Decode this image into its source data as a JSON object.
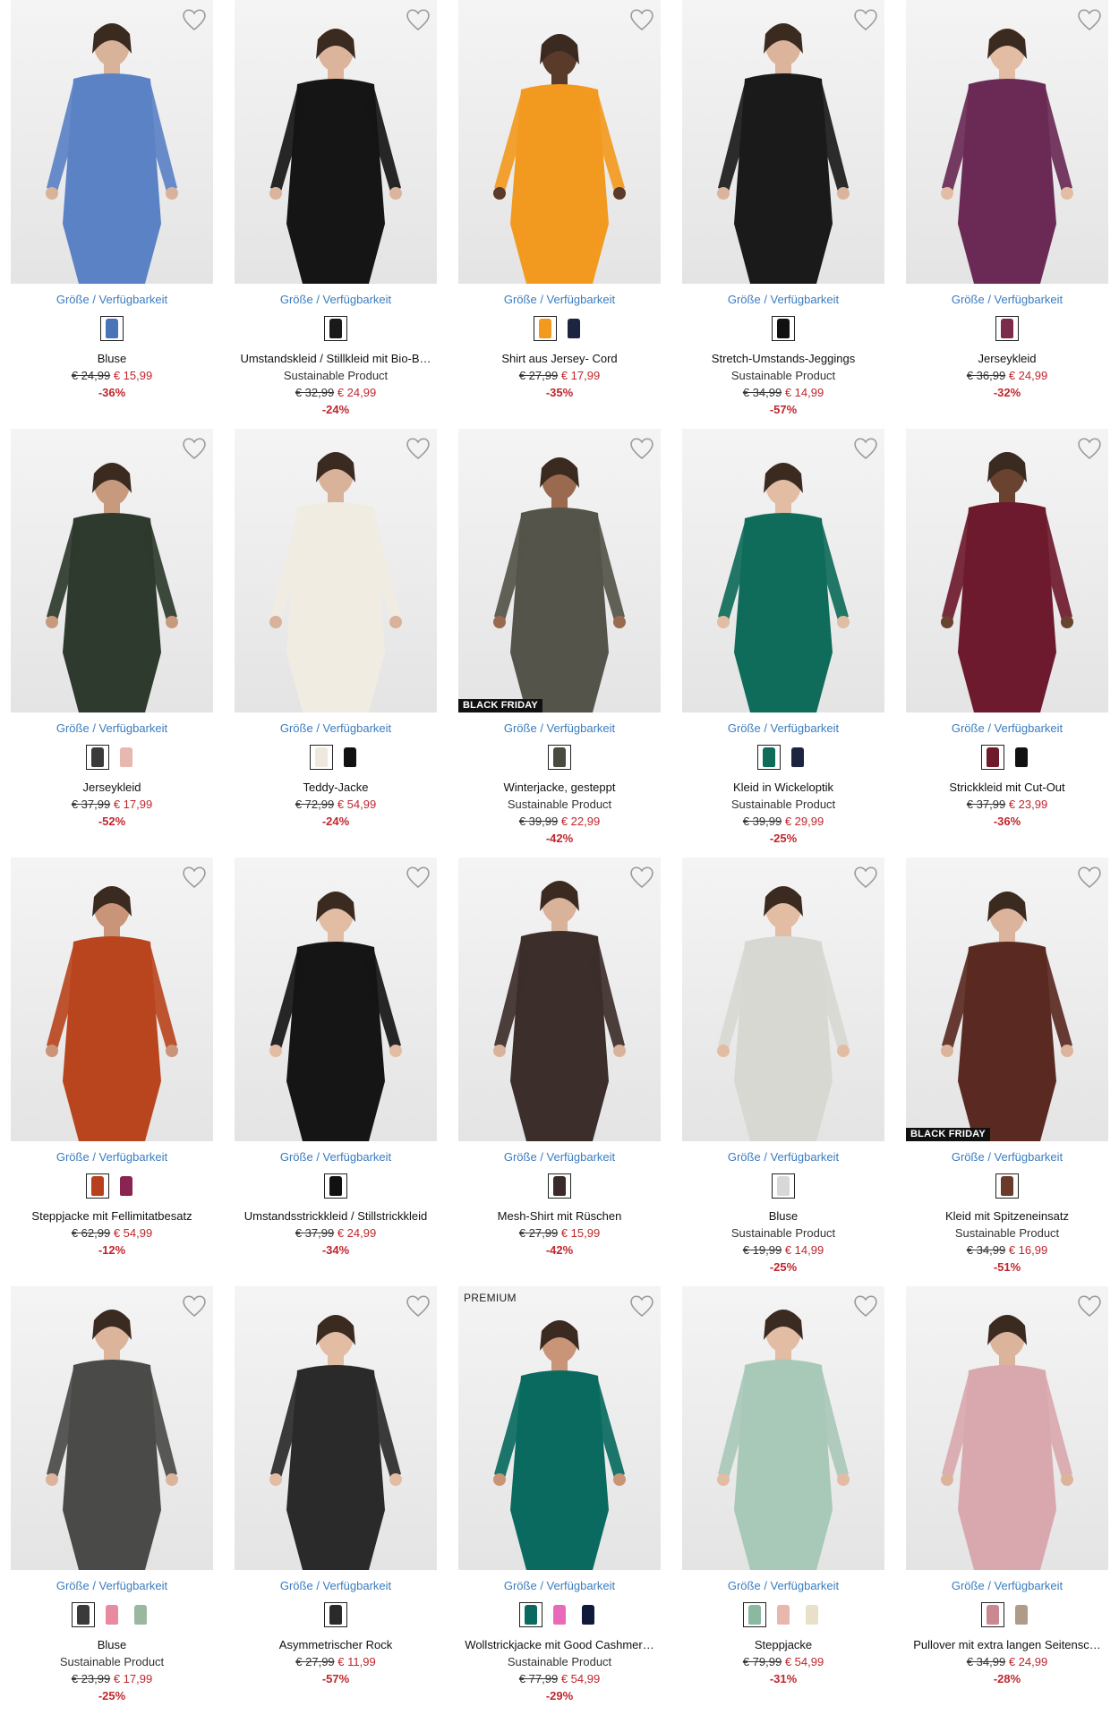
{
  "availability_label": "Größe / Verfügbarkeit",
  "colors": {
    "price_new": "#c0262d",
    "link": "#3a7cbf",
    "badge_bg": "#111111"
  },
  "products": [
    {
      "name": "Bluse",
      "sustainable": "",
      "old_price": "€ 24,99",
      "new_price": "€ 15,99",
      "discount": "-36%",
      "badge": "",
      "swatches": [
        "#4a74b8"
      ],
      "garment": "#5b82c4",
      "skin": "#d9b29a"
    },
    {
      "name": "Umstandskleid / Stillkleid mit Bio-B…",
      "sustainable": "Sustainable Product",
      "old_price": "€ 32,99",
      "new_price": "€ 24,99",
      "discount": "-24%",
      "badge": "",
      "swatches": [
        "#1a1a1a"
      ],
      "garment": "#151515",
      "skin": "#dcb49c"
    },
    {
      "name": "Shirt aus Jersey- Cord",
      "sustainable": "",
      "old_price": "€ 27,99",
      "new_price": "€ 17,99",
      "discount": "-35%",
      "badge": "",
      "swatches": [
        "#f39a1e",
        "#1c2440"
      ],
      "garment": "#f29a20",
      "skin": "#5a3a2a"
    },
    {
      "name": "Stretch-Umstands-Jeggings",
      "sustainable": "Sustainable Product",
      "old_price": "€ 34,99",
      "new_price": "€ 14,99",
      "discount": "-57%",
      "badge": "",
      "swatches": [
        "#111111"
      ],
      "garment": "#1a1a1a",
      "skin": "#dcb49c"
    },
    {
      "name": "Jerseykleid",
      "sustainable": "",
      "old_price": "€ 36,99",
      "new_price": "€ 24,99",
      "discount": "-32%",
      "badge": "",
      "swatches": [
        "#7a2c4a"
      ],
      "garment": "#6a2a55",
      "skin": "#e2bca3"
    },
    {
      "name": "Jerseykleid",
      "sustainable": "",
      "old_price": "€ 37,99",
      "new_price": "€ 17,99",
      "discount": "-52%",
      "badge": "",
      "swatches": [
        "#3a3a3a",
        "#e6b8b0"
      ],
      "garment": "#2e3a2e",
      "skin": "#c79a7e"
    },
    {
      "name": "Teddy-Jacke",
      "sustainable": "",
      "old_price": "€ 72,99",
      "new_price": "€ 54,99",
      "discount": "-24%",
      "badge": "",
      "swatches": [
        "#efe8dc",
        "#111111"
      ],
      "garment": "#f1ece2",
      "skin": "#d9b29a"
    },
    {
      "name": "Winterjacke, gesteppt",
      "sustainable": "Sustainable Product",
      "old_price": "€ 39,99",
      "new_price": "€ 22,99",
      "discount": "-42%",
      "badge": "BLACK FRIDAY",
      "swatches": [
        "#4a4a40"
      ],
      "garment": "#55544a",
      "skin": "#9a6a4e"
    },
    {
      "name": "Kleid in Wickeloptik",
      "sustainable": "Sustainable Product",
      "old_price": "€ 39,99",
      "new_price": "€ 29,99",
      "discount": "-25%",
      "badge": "",
      "swatches": [
        "#0f6b5a",
        "#1c2440"
      ],
      "garment": "#0f6b5a",
      "skin": "#e2bca3"
    },
    {
      "name": "Strickkleid mit Cut-Out",
      "sustainable": "",
      "old_price": "€ 37,99",
      "new_price": "€ 23,99",
      "discount": "-36%",
      "badge": "",
      "swatches": [
        "#6e1a2a",
        "#111111"
      ],
      "garment": "#6e1a2e",
      "skin": "#6a4230"
    },
    {
      "name": "Steppjacke mit Fellimitatbesatz",
      "sustainable": "",
      "old_price": "€ 62,99",
      "new_price": "€ 54,99",
      "discount": "-12%",
      "badge": "",
      "swatches": [
        "#b8401c",
        "#8a2450"
      ],
      "garment": "#b8451e",
      "skin": "#c99478"
    },
    {
      "name": "Umstandsstrickkleid / Stillstrickkleid",
      "sustainable": "",
      "old_price": "€ 37,99",
      "new_price": "€ 24,99",
      "discount": "-34%",
      "badge": "",
      "swatches": [
        "#111111"
      ],
      "garment": "#151515",
      "skin": "#e2bca3"
    },
    {
      "name": "Mesh-Shirt mit Rüschen",
      "sustainable": "",
      "old_price": "€ 27,99",
      "new_price": "€ 15,99",
      "discount": "-42%",
      "badge": "",
      "swatches": [
        "#3a2a2a"
      ],
      "garment": "#3c2e2a",
      "skin": "#d9b29a"
    },
    {
      "name": "Bluse",
      "sustainable": "Sustainable Product",
      "old_price": "€ 19,99",
      "new_price": "€ 14,99",
      "discount": "-25%",
      "badge": "",
      "swatches": [
        "#d8d8d8"
      ],
      "garment": "#d8d8d2",
      "skin": "#e2bca3"
    },
    {
      "name": "Kleid mit Spitzeneinsatz",
      "sustainable": "Sustainable Product",
      "old_price": "€ 34,99",
      "new_price": "€ 16,99",
      "discount": "-51%",
      "badge": "BLACK FRIDAY",
      "swatches": [
        "#6a3a2a"
      ],
      "garment": "#5a2a22",
      "skin": "#dcb49c"
    },
    {
      "name": "Bluse",
      "sustainable": "Sustainable Product",
      "old_price": "€ 23,99",
      "new_price": "€ 17,99",
      "discount": "-25%",
      "badge": "",
      "swatches": [
        "#3a3a3a",
        "#e88aa0",
        "#9ab8a0"
      ],
      "garment": "#4a4a48",
      "skin": "#dcb49c"
    },
    {
      "name": "Asymmetrischer Rock",
      "sustainable": "",
      "old_price": "€ 27,99",
      "new_price": "€ 11,99",
      "discount": "-57%",
      "badge": "",
      "swatches": [
        "#2a2a2a"
      ],
      "garment": "#2a2a2a",
      "skin": "#e2bca3"
    },
    {
      "name": "Wollstrickjacke mit Good Cashmer…",
      "sustainable": "Sustainable Product",
      "old_price": "€ 77,99",
      "new_price": "€ 54,99",
      "discount": "-29%",
      "badge": "PREMIUM",
      "swatches": [
        "#0a6a60",
        "#e86ab8",
        "#111a3a"
      ],
      "garment": "#0a6a60",
      "skin": "#c99478"
    },
    {
      "name": "Steppjacke",
      "sustainable": "",
      "old_price": "€ 79,99",
      "new_price": "€ 54,99",
      "discount": "-31%",
      "badge": "",
      "swatches": [
        "#8ab8a0",
        "#e8b8b0",
        "#e8e0c8"
      ],
      "garment": "#a8c8b8",
      "skin": "#e2bca3"
    },
    {
      "name": "Pullover mit extra langen Seitensc…",
      "sustainable": "",
      "old_price": "€ 34,99",
      "new_price": "€ 24,99",
      "discount": "-28%",
      "badge": "",
      "swatches": [
        "#c88a90",
        "#b09a88"
      ],
      "garment": "#d8a8ae",
      "skin": "#dcb49c"
    }
  ]
}
